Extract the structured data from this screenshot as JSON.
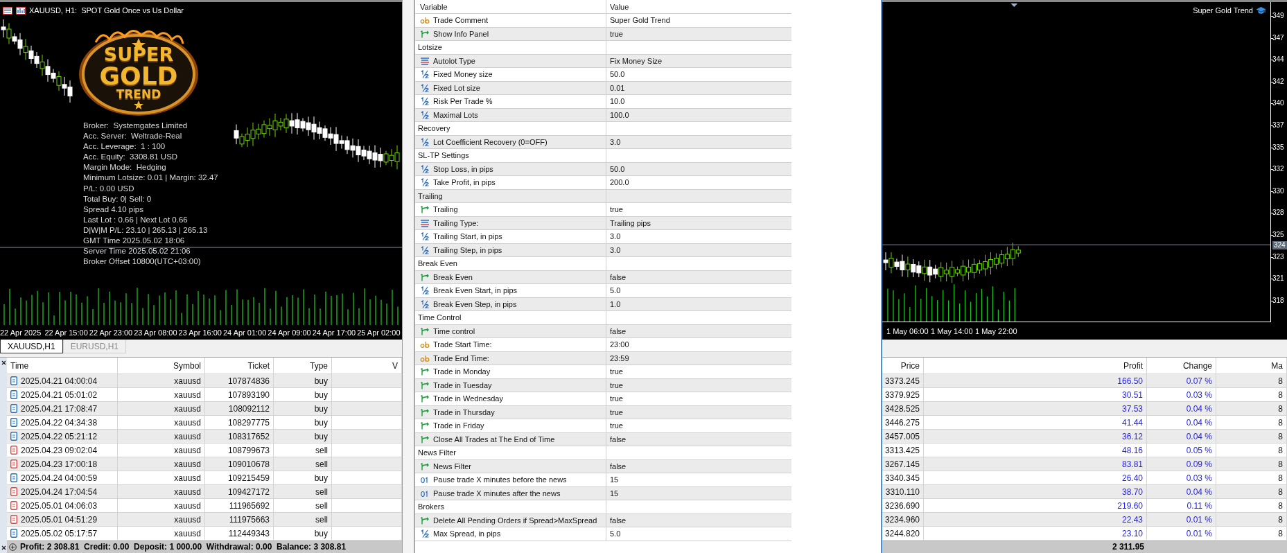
{
  "chart_left": {
    "title": "XAUUSD, H1:  SPOT Gold Once vs Us Dollar",
    "logo": [
      "SUPER",
      "GOLD",
      "TREND"
    ],
    "info_lines": [
      "Broker:  Systemgates Limited",
      "Acc. Server:  Weltrade-Real",
      "Acc. Leverage:  1 : 100",
      "Acc. Equity:  3308.81 USD",
      "Margin Mode:  Hedging",
      "Minimum Lotsize: 0.01 | Margin: 32.47",
      "P/L: 0.00 USD",
      "Total Buy: 0| Sell: 0",
      "Spread 4.10 pips",
      "Last Lot : 0.66 | Next Lot 0.66",
      "D|W|M P/L: 23.10 | 265.13 | 265.13",
      "GMT Time 2025.05.02 18:06",
      "Server Time 2025.05.02 21:06",
      "Broker Offset 10800(UTC+03:00)"
    ],
    "time_labels": [
      "22 Apr 2025",
      "22 Apr 15:00",
      "22 Apr 23:00",
      "23 Apr 08:00",
      "23 Apr 16:00",
      "24 Apr 01:00",
      "24 Apr 09:00",
      "24 Apr 17:00",
      "25 Apr 02:00"
    ]
  },
  "chart_tabs": [
    {
      "label": "XAUUSD,H1",
      "selected": true
    },
    {
      "label": "EURUSD,H1",
      "selected": false
    }
  ],
  "trade_table": {
    "columns": [
      "Time",
      "Symbol",
      "Ticket",
      "Type",
      "V"
    ],
    "rows": [
      {
        "color": "#1f6fbf",
        "cells": [
          "2025.04.21 04:00:04",
          "xauusd",
          "107874836",
          "buy"
        ]
      },
      {
        "color": "#1f6fbf",
        "cells": [
          "2025.04.21 05:01:02",
          "xauusd",
          "107893190",
          "buy"
        ]
      },
      {
        "color": "#1f6fbf",
        "cells": [
          "2025.04.21 17:08:47",
          "xauusd",
          "108092112",
          "buy"
        ]
      },
      {
        "color": "#1f6fbf",
        "cells": [
          "2025.04.22 04:34:38",
          "xauusd",
          "108297775",
          "buy"
        ]
      },
      {
        "color": "#1f6fbf",
        "cells": [
          "2025.04.22 05:21:12",
          "xauusd",
          "108317652",
          "buy"
        ]
      },
      {
        "color": "#e04444",
        "cells": [
          "2025.04.23 09:02:04",
          "xauusd",
          "108799673",
          "sell"
        ]
      },
      {
        "color": "#e04444",
        "cells": [
          "2025.04.23 17:00:18",
          "xauusd",
          "109010678",
          "sell"
        ]
      },
      {
        "color": "#1f6fbf",
        "cells": [
          "2025.04.24 04:00:59",
          "xauusd",
          "109215459",
          "buy"
        ]
      },
      {
        "color": "#e04444",
        "cells": [
          "2025.04.24 17:04:54",
          "xauusd",
          "109427172",
          "sell"
        ]
      },
      {
        "color": "#e04444",
        "cells": [
          "2025.05.01 04:06:03",
          "xauusd",
          "111965692",
          "sell"
        ]
      },
      {
        "color": "#e04444",
        "cells": [
          "2025.05.01 04:51:29",
          "xauusd",
          "111975663",
          "sell"
        ]
      },
      {
        "color": "#1f6fbf",
        "cells": [
          "2025.05.02 05:17:57",
          "xauusd",
          "112449343",
          "buy"
        ]
      }
    ],
    "summary": "Profit: 2 308.81  Credit: 0.00  Deposit: 1 000.00  Withdrawal: 0.00  Balance: 3 308.81"
  },
  "inputs_panel": {
    "columns": [
      "Variable",
      "Value"
    ],
    "rows": [
      {
        "kind": "string",
        "name": "Trade Comment",
        "value": "Super Gold Trend"
      },
      {
        "kind": "bool",
        "name": "Show Info Panel",
        "value": "true"
      },
      {
        "kind": "group",
        "name": "Lotsize"
      },
      {
        "kind": "enum",
        "name": "Autolot Type",
        "value": "Fix Money Size"
      },
      {
        "kind": "double",
        "name": "Fixed Money size",
        "value": "50.0"
      },
      {
        "kind": "double",
        "name": "Fixed Lot size",
        "value": "0.01"
      },
      {
        "kind": "double",
        "name": "Risk Per Trade %",
        "value": "10.0"
      },
      {
        "kind": "double",
        "name": "Maximal Lots",
        "value": "100.0"
      },
      {
        "kind": "group",
        "name": "Recovery"
      },
      {
        "kind": "double",
        "name": "Lot Coefficient Recovery (0=OFF)",
        "value": "3.0"
      },
      {
        "kind": "group",
        "name": "SL-TP Settings"
      },
      {
        "kind": "double",
        "name": "Stop Loss, in pips",
        "value": "50.0"
      },
      {
        "kind": "double",
        "name": "Take Profit, in pips",
        "value": "200.0"
      },
      {
        "kind": "group",
        "name": "Trailing"
      },
      {
        "kind": "bool",
        "name": "Trailing",
        "value": "true"
      },
      {
        "kind": "enum",
        "name": "Trailing Type:",
        "value": "Trailing pips"
      },
      {
        "kind": "double",
        "name": "Trailing Start, in pips",
        "value": "3.0"
      },
      {
        "kind": "double",
        "name": "Trailing Step, in pips",
        "value": "3.0"
      },
      {
        "kind": "group",
        "name": "Break Even"
      },
      {
        "kind": "bool",
        "name": "Break Even",
        "value": "false"
      },
      {
        "kind": "double",
        "name": "Break Even Start, in pips",
        "value": "5.0"
      },
      {
        "kind": "double",
        "name": "Break Even Step, in pips",
        "value": "1.0"
      },
      {
        "kind": "group",
        "name": "Time Control"
      },
      {
        "kind": "bool",
        "name": "Time control",
        "value": "false"
      },
      {
        "kind": "string",
        "name": "Trade Start Time:",
        "value": "23:00"
      },
      {
        "kind": "string",
        "name": "Trade End Time:",
        "value": "23:59"
      },
      {
        "kind": "bool",
        "name": "Trade in Monday",
        "value": "true"
      },
      {
        "kind": "bool",
        "name": "Trade in Tuesday",
        "value": "true"
      },
      {
        "kind": "bool",
        "name": "Trade in Wednesday",
        "value": "true"
      },
      {
        "kind": "bool",
        "name": "Trade in Thursday",
        "value": "true"
      },
      {
        "kind": "bool",
        "name": "Trade in Friday",
        "value": "true"
      },
      {
        "kind": "bool",
        "name": "Close All Trades at The End of Time",
        "value": "false"
      },
      {
        "kind": "group",
        "name": "News Filter"
      },
      {
        "kind": "bool",
        "name": "News Filter",
        "value": "false"
      },
      {
        "kind": "int",
        "name": "Pause trade X minutes before the news",
        "value": "15"
      },
      {
        "kind": "int",
        "name": "Pause trade X minutes after the news",
        "value": "15"
      },
      {
        "kind": "group",
        "name": "Brokers"
      },
      {
        "kind": "bool",
        "name": "Delete All Pending Orders if Spread>MaxSpread",
        "value": "false"
      },
      {
        "kind": "double",
        "name": "Max Spread, in pips",
        "value": "5.0"
      }
    ]
  },
  "chart_right": {
    "title": "Super Gold Trend",
    "price_labels": [
      "349",
      "347",
      "344",
      "342",
      "340",
      "337",
      "335",
      "332",
      "330",
      "328",
      "325",
      "323",
      "321",
      "318"
    ],
    "current_price": "324",
    "time_labels": [
      "1 May 06:00",
      "1 May 14:00",
      "1 May 22:00"
    ]
  },
  "trade_table_right": {
    "columns": [
      "Price",
      "Profit",
      "Change",
      "Ma"
    ],
    "rows": [
      [
        "3373.245",
        "166.50",
        "0.07 %",
        "8"
      ],
      [
        "3379.925",
        "30.51",
        "0.03 %",
        "8"
      ],
      [
        "3428.525",
        "37.53",
        "0.04 %",
        "8"
      ],
      [
        "3446.275",
        "41.44",
        "0.04 %",
        "8"
      ],
      [
        "3457.005",
        "36.12",
        "0.04 %",
        "8"
      ],
      [
        "3313.425",
        "48.16",
        "0.05 %",
        "8"
      ],
      [
        "3267.145",
        "83.81",
        "0.09 %",
        "8"
      ],
      [
        "3340.345",
        "26.40",
        "0.03 %",
        "8"
      ],
      [
        "3310.110",
        "38.70",
        "0.04 %",
        "8"
      ],
      [
        "3236.690",
        "219.60",
        "0.11 %",
        "8"
      ],
      [
        "3234.960",
        "22.43",
        "0.01 %",
        "8"
      ],
      [
        "3244.820",
        "23.10",
        "0.01 %",
        "8"
      ]
    ],
    "profit_total": "2 311.95"
  }
}
